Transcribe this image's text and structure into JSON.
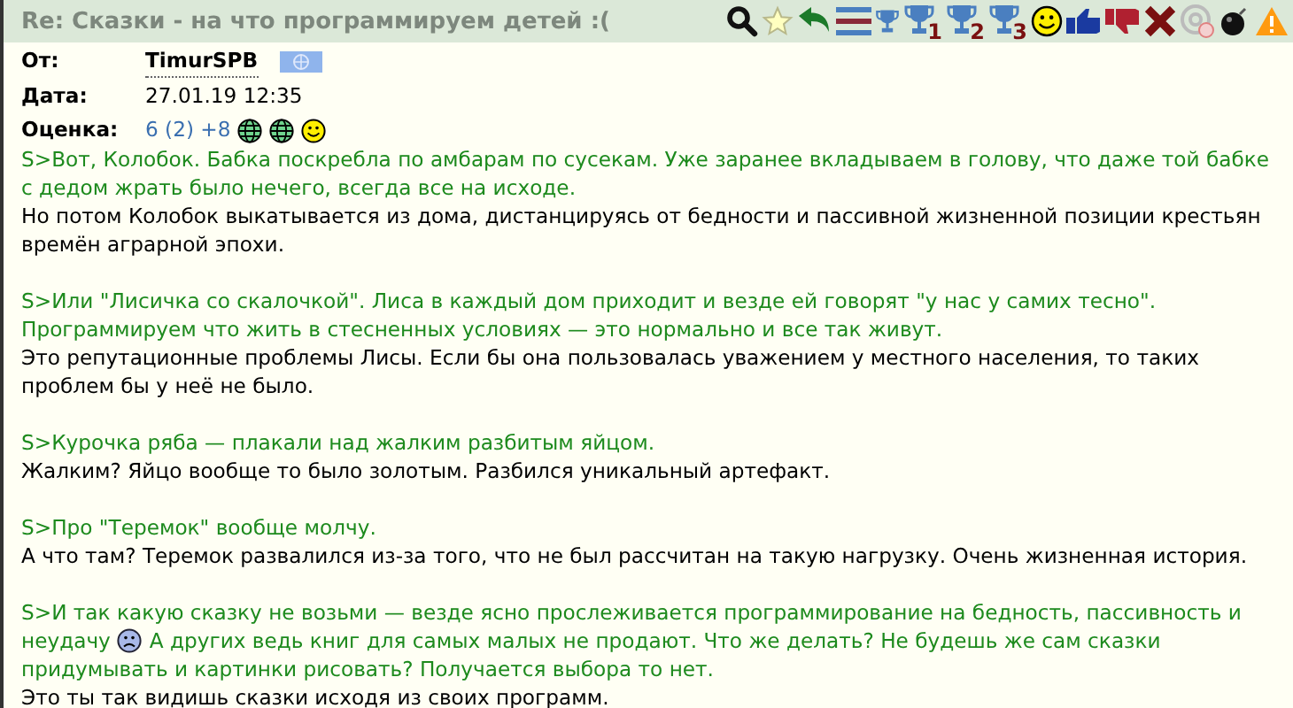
{
  "header": {
    "title": "Re: Сказки - на что программируем детей :(",
    "toolbar": [
      {
        "kind": "search"
      },
      {
        "kind": "star"
      },
      {
        "kind": "reply"
      },
      {
        "kind": "menu"
      },
      {
        "kind": "cup"
      },
      {
        "kind": "cup",
        "label": "1"
      },
      {
        "kind": "cup",
        "label": "2"
      },
      {
        "kind": "cup",
        "label": "3"
      },
      {
        "kind": "smile"
      },
      {
        "kind": "like"
      },
      {
        "kind": "dislike"
      },
      {
        "kind": "cross"
      },
      {
        "kind": "at"
      },
      {
        "kind": "bomb"
      },
      {
        "kind": "warning"
      }
    ]
  },
  "meta": {
    "from_label": "От:",
    "author": "TimurSPB",
    "date_label": "Дата:",
    "date": "27.01.19 12:35",
    "rating_label": "Оценка:",
    "rating": "6 (2) +8",
    "rating_icons": [
      {
        "kind": "globe"
      },
      {
        "kind": "globe"
      },
      {
        "kind": "smile"
      }
    ]
  },
  "blocks": [
    [
      {
        "kind": "quote",
        "text": "S>Вот, Колобок. Бабка поскребла по амбарам по сусекам. Уже заранее вкладываем в голову, что даже той бабке с дедом жрать было нечего, всегда все на исходе."
      },
      {
        "kind": "reply",
        "text": "Но потом Колобок выкатывается из дома, дистанцируясь от бедности и пассивной жизненной позиции крестьян времён аграрной эпохи."
      }
    ],
    [
      {
        "kind": "quote",
        "text": "S>Или \"Лисичка со скалочкой\". Лиса в каждый дом приходит и везде ей говорят \"у нас у самих тесно\". Программируем что жить в стесненных условиях — это нормально и все так живут."
      },
      {
        "kind": "reply",
        "text": "Это репутационные проблемы Лисы. Если бы она пользовалась уважением у местного населения, то таких проблем бы у неё не было."
      }
    ],
    [
      {
        "kind": "quote",
        "text": "S>Курочка ряба — плакали над жалким разбитым яйцом."
      },
      {
        "kind": "reply",
        "text": "Жалким? Яйцо вообще то было золотым. Разбился уникальный артефакт."
      }
    ],
    [
      {
        "kind": "quote",
        "text": "S>Про \"Теремок\" вообще молчу."
      },
      {
        "kind": "reply",
        "text": "А что там? Теремок развалился из-за того, что не был рассчитан на такую нагрузку. Очень жизненная история."
      }
    ],
    [
      {
        "kind": "quote",
        "lines": [
          [
            {
              "kind": "text",
              "text": "S>И так какую сказку не возьми — везде ясно прослеживается программирование на бедность, пассивность и"
            }
          ],
          [
            {
              "kind": "text",
              "text": "неудачу"
            },
            {
              "kind": "sad"
            },
            {
              "kind": "text",
              "text": "А других ведь книг для самых малых не продают. Что же делать? Не будешь же сам сказки"
            }
          ],
          [
            {
              "kind": "text",
              "text": "придумывать и картинки рисовать? Получается выбора то нет."
            }
          ]
        ]
      },
      {
        "kind": "reply",
        "text": "Это ты так видишь сказки исходя из своих программ."
      }
    ]
  ]
}
